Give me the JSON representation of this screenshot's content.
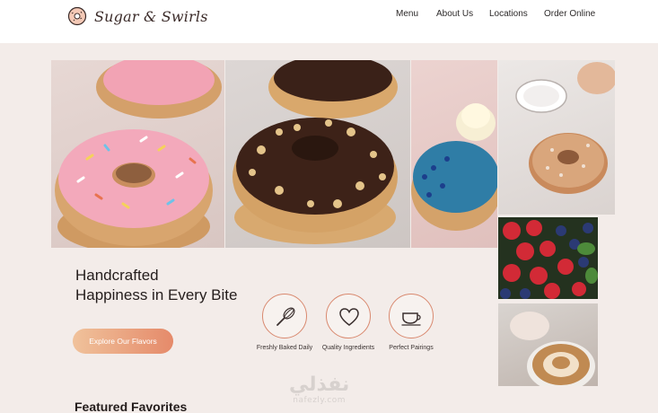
{
  "brand": {
    "name": "Sugar & Swirls",
    "logo_icon": "donut-icon"
  },
  "nav": {
    "items": [
      "Menu",
      "About Us",
      "Locations",
      "Order Online"
    ]
  },
  "hero": {
    "title_line1": "Handcrafted",
    "title_line2": "Happiness in Every Bite",
    "cta_label": "Explore Our Flavors"
  },
  "gallery": [
    {
      "subject": "pink frosted donut with sprinkles"
    },
    {
      "subject": "chocolate glazed donut with nuts"
    },
    {
      "subject": "blue glazed donut with cream"
    },
    {
      "subject": "sugar dusted donut"
    },
    {
      "subject": "strawberries and blueberries"
    },
    {
      "subject": "latte art coffee"
    }
  ],
  "features": [
    {
      "icon": "whisk-icon",
      "label": "Freshly Baked Daily"
    },
    {
      "icon": "heart-icon",
      "label": "Quality Ingredients"
    },
    {
      "icon": "coffee-cup-icon",
      "label": "Perfect Pairings"
    }
  ],
  "section": {
    "featured_title": "Featured Favorites"
  },
  "watermark": {
    "arabic": "نفذلي",
    "latin": "nafezly.com"
  },
  "colors": {
    "accent": "#d9896f",
    "cta_start": "#f0c29b",
    "cta_end": "#e58a6a",
    "background": "#f3ece9"
  }
}
